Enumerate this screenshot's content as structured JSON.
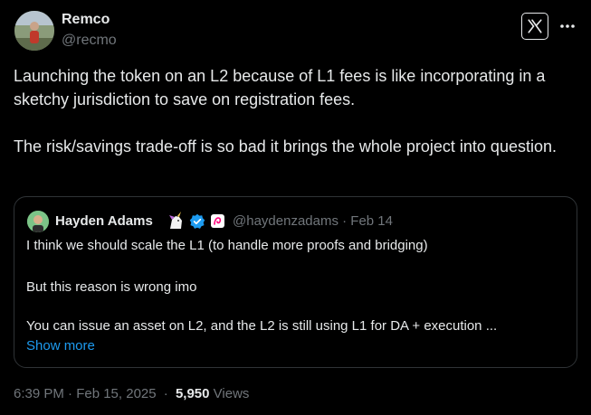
{
  "author": {
    "name": "Remco",
    "handle": "@recmo"
  },
  "tweet": {
    "paragraphs": [
      "Launching the token on an L2 because of L1 fees is like incorporating in a sketchy jurisdiction to save on registration fees.",
      "The risk/savings trade-off is so bad it brings the whole project into question."
    ]
  },
  "quote": {
    "name": "Hayden Adams",
    "handle_date": "@haydenzadams · Feb 14",
    "lines": [
      "I think we should scale the L1 (to handle more proofs and bridging)",
      "But this reason is wrong imo",
      "You can issue an asset on L2, and the L2 is still using L1 for DA + execution ..."
    ],
    "show_more": "Show more"
  },
  "footer": {
    "timestamp": "6:39 PM · Feb 15, 2025",
    "separator": "·",
    "views_count": "5,950",
    "views_label": "Views"
  },
  "icons": {
    "logo": "x-logo-icon",
    "more": "more-dots-icon",
    "verified": "verified-badge-icon",
    "unicorn": "unicorn-emoji-icon",
    "affiliate": "affiliate-badge-icon"
  },
  "colors": {
    "background": "#000000",
    "text": "#e7e9ea",
    "secondary": "#71767b",
    "accent": "#1d9bf0",
    "border": "#2f3336"
  }
}
